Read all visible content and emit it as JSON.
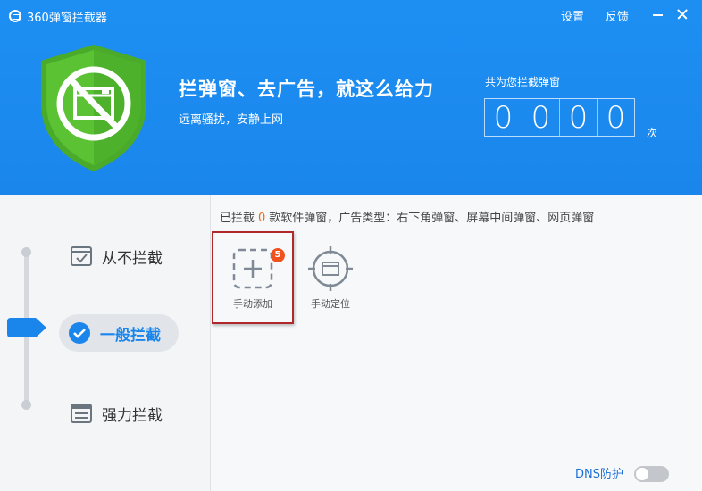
{
  "app": {
    "title": "360弹窗拦截器"
  },
  "topbar": {
    "settings": "设置",
    "feedback": "反馈"
  },
  "banner": {
    "headline": "拦弹窗、去广告，就这么给力",
    "subline": "远离骚扰，安静上网",
    "counter_label": "共为您拦截弹窗",
    "digits": [
      "0",
      "0",
      "0",
      "0"
    ],
    "counter_unit": "次"
  },
  "modes": [
    {
      "label": "从不拦截",
      "icon": "checkbox-window-icon"
    },
    {
      "label": "一般拦截",
      "icon": "check-circle-icon",
      "active": true
    },
    {
      "label": "强力拦截",
      "icon": "layers-window-icon"
    }
  ],
  "summary": {
    "prefix": "已拦截",
    "count": "0",
    "suffix": "款软件弹窗，广告类型：右下角弹窗、屏幕中间弹窗、网页弹窗"
  },
  "tools": {
    "manual_add": {
      "label": "手动添加",
      "badge": "5"
    },
    "manual_locate": {
      "label": "手动定位"
    }
  },
  "dns": {
    "label": "DNS防护",
    "enabled": false
  },
  "colors": {
    "header": "#1a86ec",
    "accent": "#1a86ec",
    "badge": "#f0521f",
    "highlight": "#b0282c",
    "count": "#f06a17"
  }
}
